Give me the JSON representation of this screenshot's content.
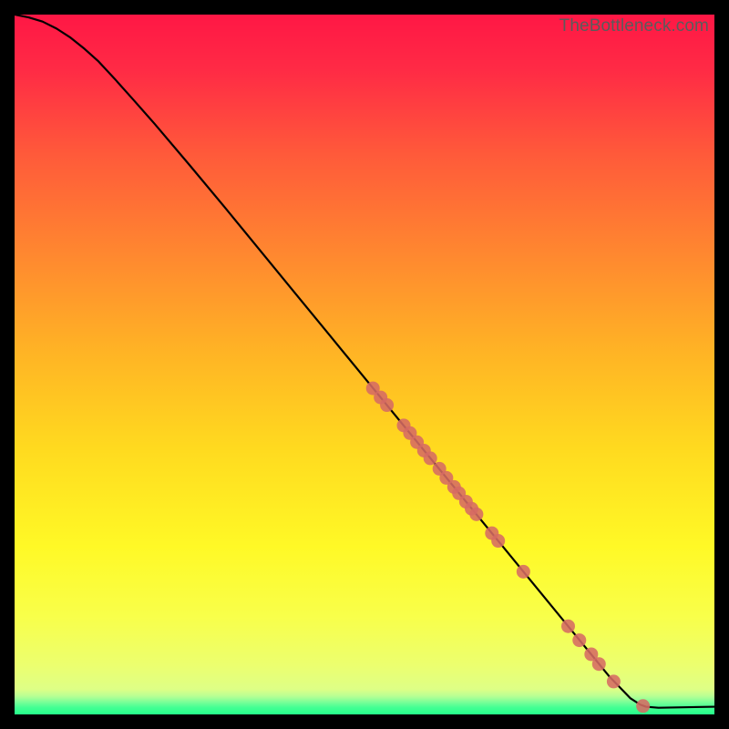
{
  "watermark": "TheBottleneck.com",
  "chart_data": {
    "type": "line",
    "title": "",
    "xlabel": "",
    "ylabel": "",
    "xlim": [
      0,
      100
    ],
    "ylim": [
      0,
      100
    ],
    "grid": false,
    "curve": [
      {
        "x": 0.0,
        "y": 100.0
      },
      {
        "x": 2.0,
        "y": 99.6
      },
      {
        "x": 4.0,
        "y": 99.0
      },
      {
        "x": 6.0,
        "y": 98.0
      },
      {
        "x": 8.0,
        "y": 96.7
      },
      {
        "x": 10.0,
        "y": 95.1
      },
      {
        "x": 12.0,
        "y": 93.3
      },
      {
        "x": 14.5,
        "y": 90.6
      },
      {
        "x": 17.0,
        "y": 87.8
      },
      {
        "x": 20.0,
        "y": 84.4
      },
      {
        "x": 25.0,
        "y": 78.5
      },
      {
        "x": 30.0,
        "y": 72.5
      },
      {
        "x": 35.0,
        "y": 66.4
      },
      {
        "x": 40.0,
        "y": 60.3
      },
      {
        "x": 45.0,
        "y": 54.2
      },
      {
        "x": 50.0,
        "y": 48.1
      },
      {
        "x": 55.0,
        "y": 42.0
      },
      {
        "x": 60.0,
        "y": 35.9
      },
      {
        "x": 65.0,
        "y": 29.8
      },
      {
        "x": 70.0,
        "y": 23.7
      },
      {
        "x": 75.0,
        "y": 17.6
      },
      {
        "x": 80.0,
        "y": 11.5
      },
      {
        "x": 85.0,
        "y": 5.4
      },
      {
        "x": 88.0,
        "y": 2.3
      },
      {
        "x": 89.4,
        "y": 1.4
      },
      {
        "x": 90.2,
        "y": 1.1
      },
      {
        "x": 92.0,
        "y": 0.95
      },
      {
        "x": 100.0,
        "y": 1.1
      }
    ],
    "dots": [
      {
        "x": 51.2,
        "y": 46.6
      },
      {
        "x": 52.3,
        "y": 45.3
      },
      {
        "x": 53.2,
        "y": 44.2
      },
      {
        "x": 55.6,
        "y": 41.3
      },
      {
        "x": 56.5,
        "y": 40.2
      },
      {
        "x": 57.5,
        "y": 38.9
      },
      {
        "x": 58.5,
        "y": 37.7
      },
      {
        "x": 59.4,
        "y": 36.6
      },
      {
        "x": 60.7,
        "y": 35.1
      },
      {
        "x": 61.7,
        "y": 33.8
      },
      {
        "x": 62.8,
        "y": 32.5
      },
      {
        "x": 63.5,
        "y": 31.6
      },
      {
        "x": 64.5,
        "y": 30.4
      },
      {
        "x": 65.3,
        "y": 29.4
      },
      {
        "x": 66.0,
        "y": 28.6
      },
      {
        "x": 68.2,
        "y": 25.9
      },
      {
        "x": 69.1,
        "y": 24.8
      },
      {
        "x": 72.7,
        "y": 20.4
      },
      {
        "x": 79.1,
        "y": 12.6
      },
      {
        "x": 80.7,
        "y": 10.6
      },
      {
        "x": 82.4,
        "y": 8.6
      },
      {
        "x": 83.5,
        "y": 7.2
      },
      {
        "x": 85.6,
        "y": 4.7
      },
      {
        "x": 89.8,
        "y": 1.2
      }
    ],
    "dot_color": "#d66b63",
    "line_color": "#000000",
    "green_band": {
      "from_y": 0.0,
      "to_y": 1.8,
      "top_color": "#3fff9f",
      "bottom_color": "#28ff8a"
    }
  }
}
